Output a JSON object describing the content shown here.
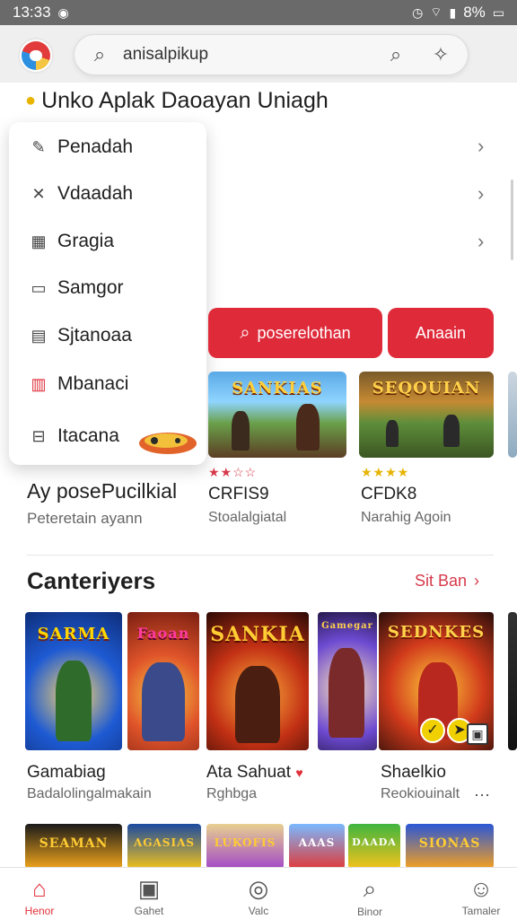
{
  "status_bar": {
    "time": "13:33",
    "battery": "8%"
  },
  "header": {
    "search": {
      "value": "anisalpikup"
    }
  },
  "top_section": {
    "title": "Unko Aplak Daoayan Uniagh"
  },
  "menu": {
    "items": [
      {
        "label": "Penadah",
        "icon": "pencil-icon"
      },
      {
        "label": "Vdaadah",
        "icon": "tools-icon"
      },
      {
        "label": "Gragia",
        "icon": "grid-icon"
      },
      {
        "label": "Samgor",
        "icon": "image-icon"
      },
      {
        "label": "Sjtanoaa",
        "icon": "calendar-icon"
      },
      {
        "label": "Mbanaci",
        "icon": "book-icon"
      },
      {
        "label": "Itacana",
        "icon": "bag-icon"
      }
    ]
  },
  "actions": {
    "primary_label": "poserelothan",
    "secondary_label": "Anaain"
  },
  "featured": {
    "main": {
      "title": "Ay posePucilkial",
      "subtitle": "Peteretain ayann"
    },
    "cards": [
      {
        "art": "SANKIAS",
        "title": "CRFIS9",
        "subtitle": "Stoalalgiatal",
        "stars": "★★☆☆"
      },
      {
        "art": "SEQOUIAN",
        "title": "CFDK8",
        "subtitle": "Narahig Agoin",
        "stars": "★★★★"
      }
    ]
  },
  "categories": {
    "title": "Canteriyers",
    "see_all": "Sit Ban",
    "cards": [
      {
        "art": "SARMA",
        "title": "Gamabiag",
        "subtitle": "Badalolingalmakain"
      },
      {
        "art": "Faoan",
        "title": "",
        "subtitle": ""
      },
      {
        "art": "SANKIA",
        "title": "Ata Sahuat",
        "subtitle": "Rghbga"
      },
      {
        "art": "Gamegar",
        "title": "",
        "subtitle": ""
      },
      {
        "art": "SEDNKES",
        "title": "Shaelkio",
        "subtitle": "Reokiouinalt"
      }
    ],
    "row3": [
      {
        "art": "SEAMAN"
      },
      {
        "art": "AGASIAS"
      },
      {
        "art": "LUKOFIS"
      },
      {
        "art": "AAAS"
      },
      {
        "art": "DAADA"
      },
      {
        "art": "SIONAS"
      }
    ]
  },
  "bottom_nav": {
    "items": [
      {
        "label": "Henor",
        "icon": "home-icon",
        "active": true
      },
      {
        "label": "Gahet",
        "icon": "box-icon",
        "active": false
      },
      {
        "label": "Valc",
        "icon": "compass-icon",
        "active": false
      },
      {
        "label": "Binor",
        "icon": "search-icon",
        "active": false
      },
      {
        "label": "Tamaler",
        "icon": "profile-icon",
        "active": false
      }
    ]
  },
  "colors": {
    "accent": "#df2a3a",
    "star_active": "#e6b400",
    "star_red": "#d6394a"
  }
}
